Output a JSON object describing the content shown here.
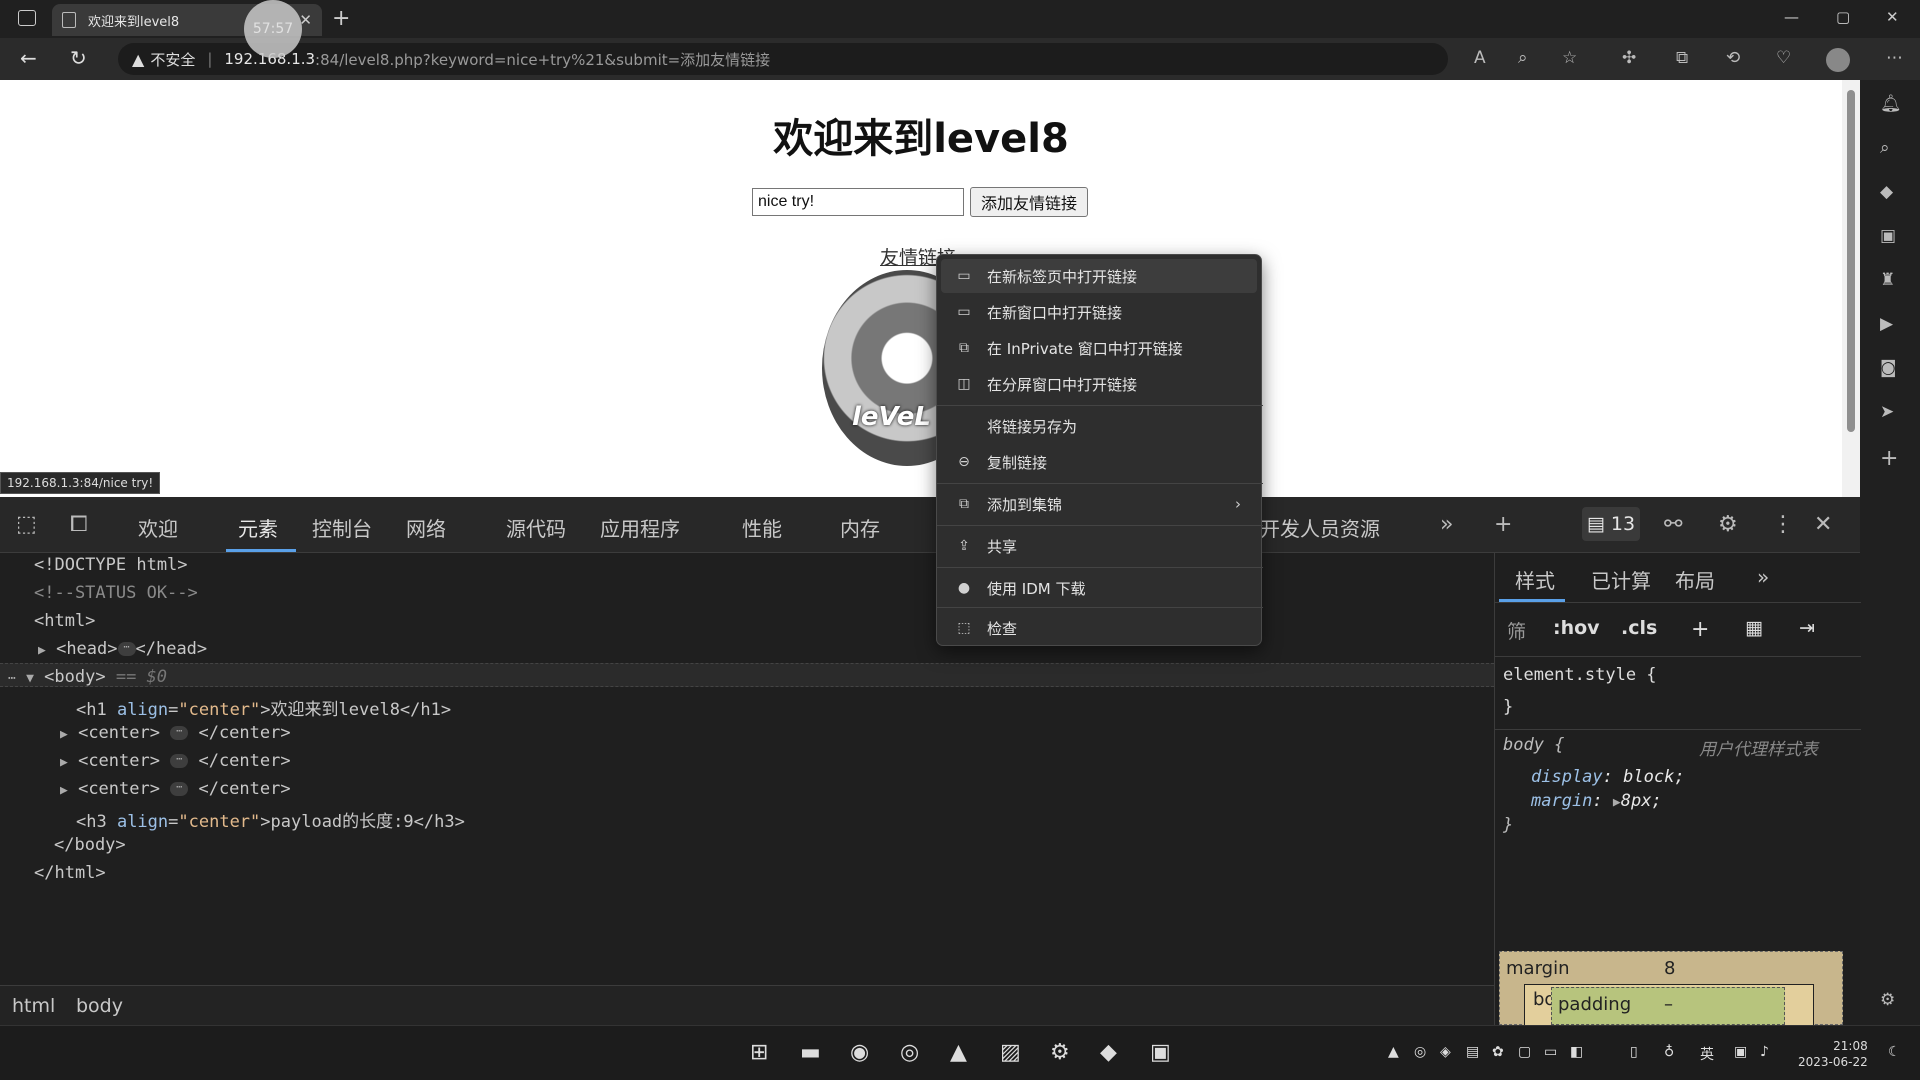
{
  "browser": {
    "tab_title": "欢迎来到level8",
    "timer": "57:57",
    "url_warning": "不安全",
    "url_host": "192.168.1.3",
    "url_path": ":84/level8.php?keyword=nice+try%21&submit=添加友情链接"
  },
  "page": {
    "heading": "欢迎来到level8",
    "keyword_value": "nice try!",
    "submit_label": "添加友情链接",
    "friend_link": "友情链接",
    "logo_text": "leVeL",
    "status_url": "192.168.1.3:84/nice try!"
  },
  "context_menu": {
    "items": [
      {
        "label": "在新标签页中打开链接",
        "icon": "new-tab-icon"
      },
      {
        "label": "在新窗口中打开链接",
        "icon": "new-window-icon"
      },
      {
        "label": "在 InPrivate 窗口中打开链接",
        "icon": "inprivate-icon"
      },
      {
        "label": "在分屏窗口中打开链接",
        "icon": "split-screen-icon"
      },
      {
        "label": "将链接另存为",
        "icon": ""
      },
      {
        "label": "复制链接",
        "icon": "link-icon"
      },
      {
        "label": "添加到集锦",
        "icon": "collections-icon"
      },
      {
        "label": "共享",
        "icon": "share-icon"
      },
      {
        "label": "使用 IDM 下载",
        "icon": "idm-icon"
      },
      {
        "label": "检查",
        "icon": "inspect-icon"
      }
    ]
  },
  "devtools": {
    "tabs": [
      "欢迎",
      "元素",
      "控制台",
      "网络",
      "源代码",
      "应用程序",
      "性能",
      "内存",
      "开发人员资源"
    ],
    "issues_count": "13",
    "dom": {
      "doctype": "<!DOCTYPE html>",
      "comment": "<!--STATUS OK-->",
      "html_open": "<html>",
      "head": "<head>",
      "head_close": "</head>",
      "body_open": "<body>",
      "body_marker": "== $0",
      "h1_open": "<h1 ",
      "h1_attr": "align",
      "h1_val": "\"center\"",
      "h1_text": ">欢迎来到level8</h1>",
      "center_open": "<center>",
      "center_close": "</center>",
      "h3_open": "<h3 ",
      "h3_attr": "align",
      "h3_val": "\"center\"",
      "h3_text": ">payload的长度:9</h3>",
      "body_close": "</body>",
      "html_close": "</html>"
    },
    "breadcrumbs": [
      "html",
      "body"
    ],
    "styles": {
      "tabs": [
        "样式",
        "已计算",
        "布局"
      ],
      "filter_label": "筛",
      "hov": ":hov",
      "cls": ".cls",
      "element_style": "element.style {",
      "close_brace": "}",
      "body_selector": "body {",
      "ua_label": "用户代理样式表",
      "display_prop": "display",
      "display_val": "block;",
      "margin_prop": "margin",
      "margin_val": "8px;",
      "box_margin_label": "margin",
      "box_margin_val": "8",
      "box_border_label": "border",
      "box_border_val": "–",
      "box_padding_label": "padding",
      "box_padding_val": "–"
    }
  },
  "taskbar": {
    "time": "21:08",
    "date": "2023-06-22",
    "ime": "英"
  }
}
